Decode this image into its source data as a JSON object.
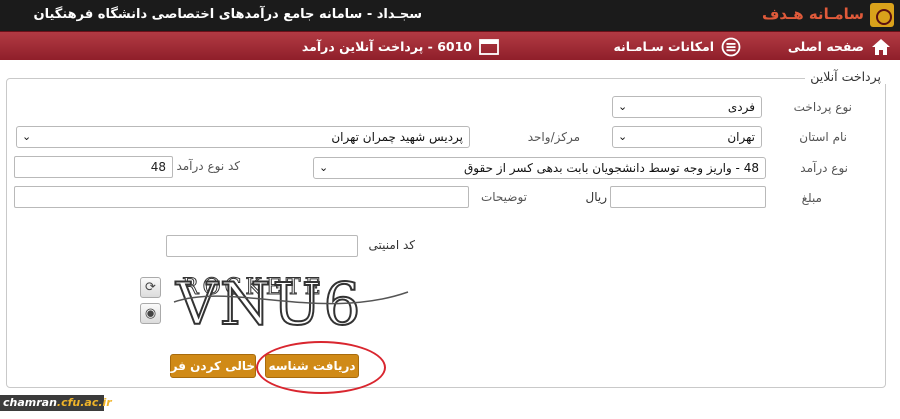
{
  "header": {
    "app_title": "سجـداد - سامانه جامع درآمدهای اختصاصی دانشگاه فرهنگیان",
    "logo_text": "سامـانه هـدف"
  },
  "nav": {
    "home_label": "صفحه اصلی",
    "features_label": "امکانات سـامـانه",
    "current_label": "6010 - پرداخت آنلاین درآمد"
  },
  "form": {
    "legend": "پرداخت آنلاین",
    "payment_type_label": "نوع پرداخت",
    "payment_type_value": "فردی",
    "province_label": "نام استان",
    "province_value": "تهران",
    "center_label": "مرکز/واحد",
    "center_value": "پردیس شهید چمران تهران",
    "income_type_label": "نوع درآمد",
    "income_type_value": "48 - واریز وجه توسط دانشجویان بابت بدهی کسر از حقوق",
    "income_code_label": "کد نوع درآمد",
    "income_code_value": "48",
    "amount_label": "مبلغ",
    "amount_value": "",
    "currency_label": "ریال",
    "description_label": "توضیحات",
    "description_value": "",
    "security_code_label": "کد امنیتی",
    "security_code_value": ""
  },
  "captcha": {
    "text": "VNU6",
    "strike_text": "ROCKETE"
  },
  "buttons": {
    "get_id_label": "دریافت شناسه",
    "clear_form_label": "خالی کردن فرم"
  },
  "watermark": {
    "site": "chamran",
    "domain": ".cfu.ac.ir"
  },
  "icons": {
    "home": "home-icon",
    "features": "list-icon",
    "current": "window-icon",
    "refresh": "refresh-icon",
    "audio": "speaker-icon"
  },
  "colors": {
    "topbar": "#1b1b1b",
    "navbar": "#a3303a",
    "button": "#d08a17",
    "highlight": "#d9262f"
  }
}
